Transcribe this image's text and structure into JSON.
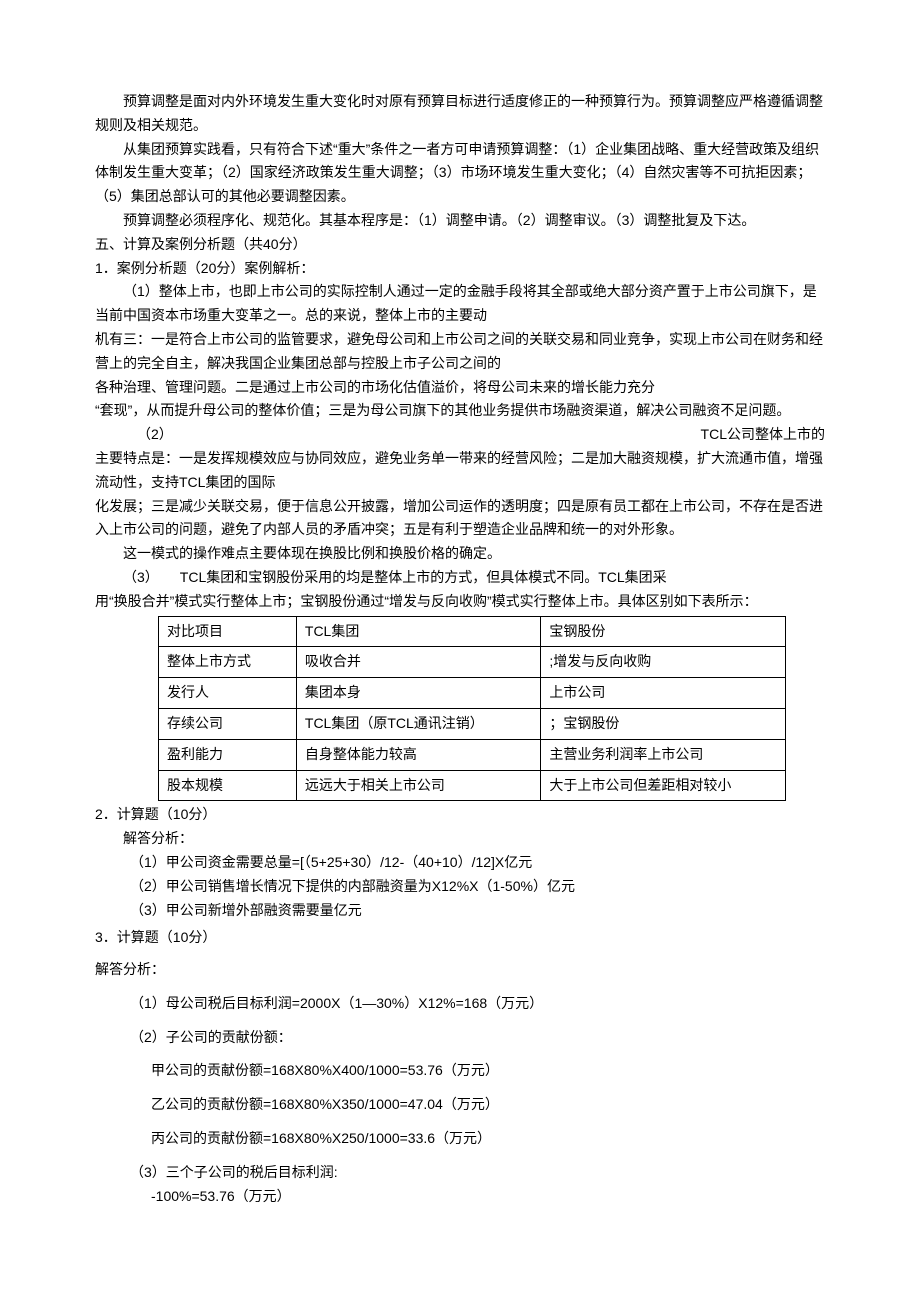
{
  "p1": "预算调整是面对内外环境发生重大变化时对原有预算目标进行适度修正的一种预算行为。预算调整应严格遵循调整规则及相关规范。",
  "p2": "从集团预算实践看，只有符合下述“重大”条件之一者方可申请预算调整：（1）企业集团战略、重大经营政策及组织体制发生重大变革；（2）国家经济政策发生重大调整；（3）市场环境发生重大变化；（4）自然灾害等不可抗拒因素；（5）集团总部认可的其他必要调整因素。",
  "p3": "预算调整必须程序化、规范化。其基本程序是：（1）调整申请。（2）调整审议。（3）调整批复及下达。",
  "h5": "五、计算及案例分析题（共40分）",
  "q1": "1．案例分析题（20分）案例解析：",
  "q1_1": "（1）整体上市，也即上市公司的实际控制人通过一定的金融手段将其全部或绝大部分资产置于上市公司旗下，是当前中国资本市场重大变革之一。总的来说，整体上市的主要动",
  "q1_2": "机有三：一是符合上市公司的监管要求，避免母公司和上市公司之间的关联交易和同业竞争，实现上市公司在财务和经营上的完全自主，解决我国企业集团总部与控股上市子公司之间的",
  "q1_3": "各种治理、管理问题。二是通过上市公司的市场化估值溢价，将母公司未来的增长能力充分",
  "q1_4": "“套现”，从而提升母公司的整体价值；三是为母公司旗下的其他业务提供市场融资渠道，解决公司融资不足问题。",
  "q1_5a": "（2）",
  "q1_5b": "TCL公司整体上市的",
  "q1_6": "主要特点是：一是发挥规模效应与协同效应，避免业务单一带来的经营风险；二是加大融资规模，扩大流通市值，增强流动性，支持TCL集团的国际",
  "q1_7": "化发展；三是减少关联交易，便于信息公开披露，增加公司运作的透明度；四是原有员工都在上市公司，不存在是否进入上市公司的问题，避免了内部人员的矛盾冲突；五是有利于塑造企业品牌和统一的对外形象。",
  "q1_8": "这一模式的操作难点主要体现在换股比例和换股价格的确定。",
  "q1_9": "（3）　　TCL集团和宝钢股份采用的均是整体上市的方式，但具体模式不同。TCL集团采",
  "q1_10": "用“换股合并”模式实行整体上市；宝钢股份通过“增发与反向收购”模式实行整体上市。具体区别如下表所示：",
  "table": {
    "rows": [
      [
        "对比项目",
        "TCL集团",
        "宝钢股份"
      ],
      [
        "整体上市方式",
        "吸收合并",
        ";增发与反向收购"
      ],
      [
        "发行人",
        "集团本身",
        "上市公司"
      ],
      [
        "存续公司",
        "TCL集团（原TCL通讯注销）",
        "；宝钢股份"
      ],
      [
        "盈利能力",
        "自身整体能力较高",
        "主营业务利润率上市公司"
      ],
      [
        "股本规模",
        "远远大于相关上市公司",
        "大于上市公司但差距相对较小"
      ]
    ]
  },
  "q2": "2．计算题（10分）",
  "q2_a": "解答分析：",
  "q2_1": "（1）甲公司资金需要总量=[（5+25+30）/12-（40+10）/12]X亿元",
  "q2_2": "（2）甲公司销售增长情况下提供的内部融资量为X12%X（1-50%）亿元",
  "q2_3": "（3）甲公司新增外部融资需要量亿元",
  "q3": "3．计算题（10分）",
  "q3_a": "解答分析：",
  "q3_1": "（1）母公司税后目标利润=2000X（1—30%）X12%=168（万元）",
  "q3_2": "（2）子公司的贡献份额：",
  "q3_2a": "甲公司的贡献份额=168X80%X400/1000=53.76（万元）",
  "q3_2b": "乙公司的贡献份额=168X80%X350/1000=47.04（万元）",
  "q3_2c": "丙公司的贡献份额=168X80%X250/1000=33.6（万元）",
  "q3_3": "（3）三个子公司的税后目标利润:",
  "q3_3a": "-100%=53.76（万元）"
}
